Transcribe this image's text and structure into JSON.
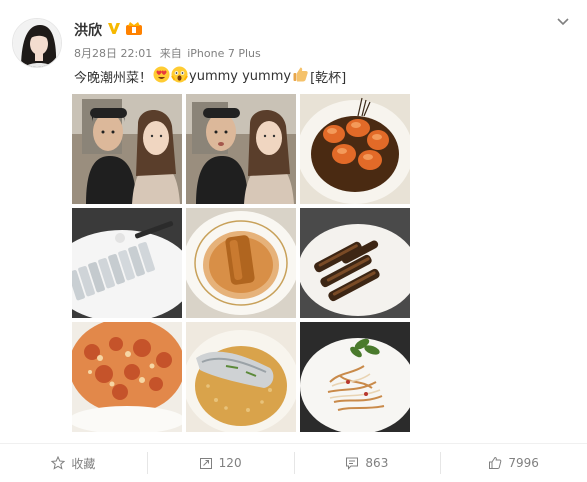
{
  "post": {
    "username": "洪欣",
    "timestamp": "8月28日 22:01",
    "source_prefix": "来自",
    "source_device": "iPhone 7 Plus",
    "text_before": "今晚潮州菜！",
    "text_middle": "yummy yummy",
    "text_tag": "[乾杯]",
    "images": [
      {
        "subject": "selfie-couple-1"
      },
      {
        "subject": "selfie-couple-2"
      },
      {
        "subject": "fried-shrimp"
      },
      {
        "subject": "sliced-fish-plate"
      },
      {
        "subject": "braised-dish-bowl"
      },
      {
        "subject": "braised-goose-slices"
      },
      {
        "subject": "crab-omelette"
      },
      {
        "subject": "fish-in-soup"
      },
      {
        "subject": "jellyfish-salad"
      }
    ]
  },
  "actions": {
    "favorite_label": "收藏",
    "repost_count": "120",
    "comment_count": "863",
    "like_count": "7996"
  },
  "colors": {
    "text": "#333333",
    "meta": "#808080",
    "verified_gold": "#f6b800",
    "divider": "#f0f0f0"
  }
}
